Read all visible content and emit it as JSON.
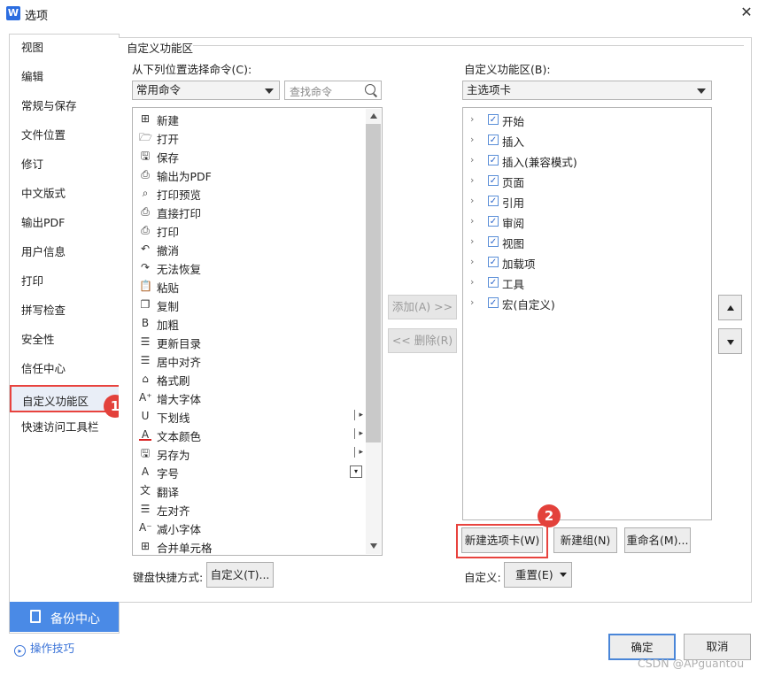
{
  "window": {
    "title": "选项",
    "app_icon_letter": "W"
  },
  "sidebar": {
    "items": [
      "视图",
      "编辑",
      "常规与保存",
      "文件位置",
      "修订",
      "中文版式",
      "输出PDF",
      "用户信息",
      "打印",
      "拼写检查",
      "安全性",
      "信任中心",
      "自定义功能区",
      "快速访问工具栏"
    ],
    "active_index": 12,
    "backup_label": "备份中心",
    "tips_label": "操作技巧"
  },
  "badges": {
    "one": "1",
    "two": "2"
  },
  "main": {
    "section_title": "自定义功能区",
    "left_label": "从下列位置选择命令(C):",
    "left_combo": "常用命令",
    "search_placeholder": "查找命令",
    "commands": [
      {
        "label": "新建",
        "icon": "new-doc-icon",
        "glyph": "⊞"
      },
      {
        "label": "打开",
        "icon": "folder-open-icon",
        "glyph": "🗁"
      },
      {
        "label": "保存",
        "icon": "save-icon",
        "glyph": "🖫"
      },
      {
        "label": "输出为PDF",
        "icon": "pdf-export-icon",
        "glyph": "⎙"
      },
      {
        "label": "打印预览",
        "icon": "print-preview-icon",
        "glyph": "⌕"
      },
      {
        "label": "直接打印",
        "icon": "direct-print-icon",
        "glyph": "⎙"
      },
      {
        "label": "打印",
        "icon": "print-icon",
        "glyph": "⎙"
      },
      {
        "label": "撤消",
        "icon": "undo-icon",
        "glyph": "↶"
      },
      {
        "label": "无法恢复",
        "icon": "redo-icon",
        "glyph": "↷"
      },
      {
        "label": "粘贴",
        "icon": "paste-icon",
        "glyph": "📋"
      },
      {
        "label": "复制",
        "icon": "copy-icon",
        "glyph": "❐"
      },
      {
        "label": "加粗",
        "icon": "bold-icon",
        "glyph": "B"
      },
      {
        "label": "更新目录",
        "icon": "update-toc-icon",
        "glyph": "☰"
      },
      {
        "label": "居中对齐",
        "icon": "align-center-icon",
        "glyph": "☰"
      },
      {
        "label": "格式刷",
        "icon": "format-painter-icon",
        "glyph": "⌂"
      },
      {
        "label": "增大字体",
        "icon": "font-grow-icon",
        "glyph": "A⁺"
      },
      {
        "label": "下划线",
        "icon": "underline-icon",
        "glyph": "U",
        "sub": "arrow"
      },
      {
        "label": "文本颜色",
        "icon": "text-color-icon",
        "glyph": "A",
        "sub": "arrow"
      },
      {
        "label": "另存为",
        "icon": "save-as-icon",
        "glyph": "🖫",
        "sub": "arrow"
      },
      {
        "label": "字号",
        "icon": "font-size-icon",
        "glyph": "A",
        "sub": "dropdown"
      },
      {
        "label": "翻译",
        "icon": "translate-icon",
        "glyph": "文"
      },
      {
        "label": "左对齐",
        "icon": "align-left-icon",
        "glyph": "☰"
      },
      {
        "label": "减小字体",
        "icon": "font-shrink-icon",
        "glyph": "A⁻"
      },
      {
        "label": "合并单元格",
        "icon": "merge-cells-icon",
        "glyph": "⊞"
      }
    ],
    "add_button": "添加(A) >>",
    "remove_button": "<< 删除(R)",
    "right_label": "自定义功能区(B):",
    "right_combo": "主选项卡",
    "tabs": [
      "开始",
      "插入",
      "插入(兼容模式)",
      "页面",
      "引用",
      "审阅",
      "视图",
      "加载项",
      "工具",
      "宏(自定义)"
    ],
    "new_tab_button": "新建选项卡(W)",
    "new_group_button": "新建组(N)",
    "rename_button": "重命名(M)...",
    "keyboard_label": "键盘快捷方式:",
    "customize_button": "自定义(T)...",
    "custom_label": "自定义:",
    "reset_button": "重置(E)"
  },
  "footer": {
    "ok": "确定",
    "cancel": "取消",
    "watermark": "CSDN @APguantou"
  }
}
